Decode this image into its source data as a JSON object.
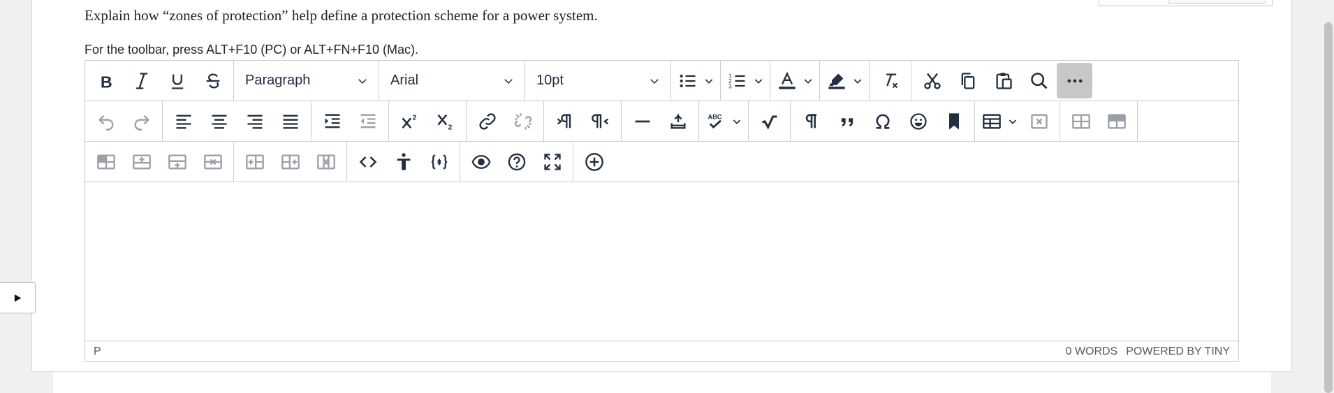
{
  "question": {
    "text": "Explain how “zones of protection” help define a protection scheme for a power system."
  },
  "editor": {
    "hint": "For the toolbar, press ALT+F10 (PC) or ALT+FN+F10 (Mac).",
    "block_format": "Paragraph",
    "font_family": "Arial",
    "font_size": "10pt",
    "content": "",
    "status": {
      "path": "P",
      "word_count": "0 WORDS",
      "branding": "POWERED BY TINY"
    }
  },
  "colors": {
    "icon": "#222f3e",
    "border": "#cccccc",
    "active_button_bg": "#c7c7c7",
    "disabled_icon": "#8a8f98",
    "page_bg": "#f0f0f0"
  }
}
